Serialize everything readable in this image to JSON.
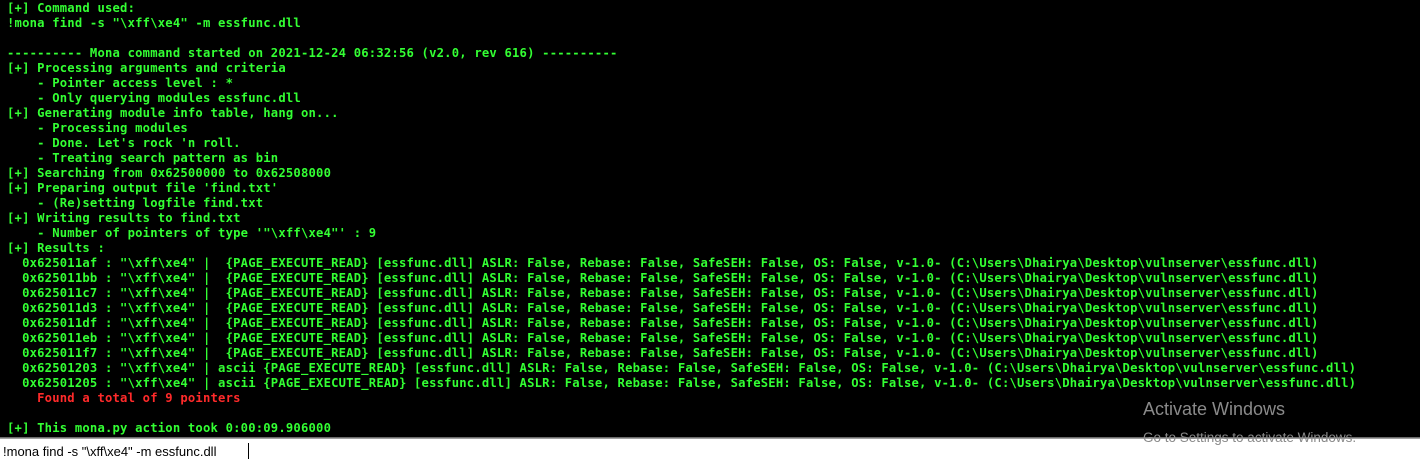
{
  "console": {
    "lines": [
      {
        "text": "[+] Command used:"
      },
      {
        "text": "!mona find -s \"\\xff\\xe4\" -m essfunc.dll"
      },
      {
        "text": ""
      },
      {
        "text": "---------- Mona command started on 2021-12-24 06:32:56 (v2.0, rev 616) ----------"
      },
      {
        "text": "[+] Processing arguments and criteria"
      },
      {
        "text": "    - Pointer access level : *"
      },
      {
        "text": "    - Only querying modules essfunc.dll"
      },
      {
        "text": "[+] Generating module info table, hang on..."
      },
      {
        "text": "    - Processing modules"
      },
      {
        "text": "    - Done. Let's rock 'n roll."
      },
      {
        "text": "    - Treating search pattern as bin"
      },
      {
        "text": "[+] Searching from 0x62500000 to 0x62508000"
      },
      {
        "text": "[+] Preparing output file 'find.txt'"
      },
      {
        "text": "    - (Re)setting logfile find.txt"
      },
      {
        "text": "[+] Writing results to find.txt"
      },
      {
        "text": "    - Number of pointers of type '\"\\xff\\xe4\"' : 9"
      },
      {
        "text": "[+] Results :"
      },
      {
        "text": "  0x625011af : \"\\xff\\xe4\" |  {PAGE_EXECUTE_READ} [essfunc.dll] ASLR: False, Rebase: False, SafeSEH: False, OS: False, v-1.0- (C:\\Users\\Dhairya\\Desktop\\vulnserver\\essfunc.dll)"
      },
      {
        "text": "  0x625011bb : \"\\xff\\xe4\" |  {PAGE_EXECUTE_READ} [essfunc.dll] ASLR: False, Rebase: False, SafeSEH: False, OS: False, v-1.0- (C:\\Users\\Dhairya\\Desktop\\vulnserver\\essfunc.dll)"
      },
      {
        "text": "  0x625011c7 : \"\\xff\\xe4\" |  {PAGE_EXECUTE_READ} [essfunc.dll] ASLR: False, Rebase: False, SafeSEH: False, OS: False, v-1.0- (C:\\Users\\Dhairya\\Desktop\\vulnserver\\essfunc.dll)"
      },
      {
        "text": "  0x625011d3 : \"\\xff\\xe4\" |  {PAGE_EXECUTE_READ} [essfunc.dll] ASLR: False, Rebase: False, SafeSEH: False, OS: False, v-1.0- (C:\\Users\\Dhairya\\Desktop\\vulnserver\\essfunc.dll)"
      },
      {
        "text": "  0x625011df : \"\\xff\\xe4\" |  {PAGE_EXECUTE_READ} [essfunc.dll] ASLR: False, Rebase: False, SafeSEH: False, OS: False, v-1.0- (C:\\Users\\Dhairya\\Desktop\\vulnserver\\essfunc.dll)"
      },
      {
        "text": "  0x625011eb : \"\\xff\\xe4\" |  {PAGE_EXECUTE_READ} [essfunc.dll] ASLR: False, Rebase: False, SafeSEH: False, OS: False, v-1.0- (C:\\Users\\Dhairya\\Desktop\\vulnserver\\essfunc.dll)"
      },
      {
        "text": "  0x625011f7 : \"\\xff\\xe4\" |  {PAGE_EXECUTE_READ} [essfunc.dll] ASLR: False, Rebase: False, SafeSEH: False, OS: False, v-1.0- (C:\\Users\\Dhairya\\Desktop\\vulnserver\\essfunc.dll)"
      },
      {
        "text": "  0x62501203 : \"\\xff\\xe4\" | ascii {PAGE_EXECUTE_READ} [essfunc.dll] ASLR: False, Rebase: False, SafeSEH: False, OS: False, v-1.0- (C:\\Users\\Dhairya\\Desktop\\vulnserver\\essfunc.dll)"
      },
      {
        "text": "  0x62501205 : \"\\xff\\xe4\" | ascii {PAGE_EXECUTE_READ} [essfunc.dll] ASLR: False, Rebase: False, SafeSEH: False, OS: False, v-1.0- (C:\\Users\\Dhairya\\Desktop\\vulnserver\\essfunc.dll)"
      },
      {
        "text": "    Found a total of 9 pointers",
        "color": "red"
      },
      {
        "text": ""
      },
      {
        "text": "[+] This mona.py action took 0:00:09.906000"
      }
    ]
  },
  "command_bar": {
    "value": "!mona find -s \"\\xff\\xe4\" -m essfunc.dll"
  },
  "watermark": {
    "title": "Activate Windows",
    "subtitle": "Go to Settings to activate Windows."
  },
  "colors": {
    "console_text": "#33ff33",
    "console_error": "#ff2a2a",
    "console_background": "#000000"
  }
}
